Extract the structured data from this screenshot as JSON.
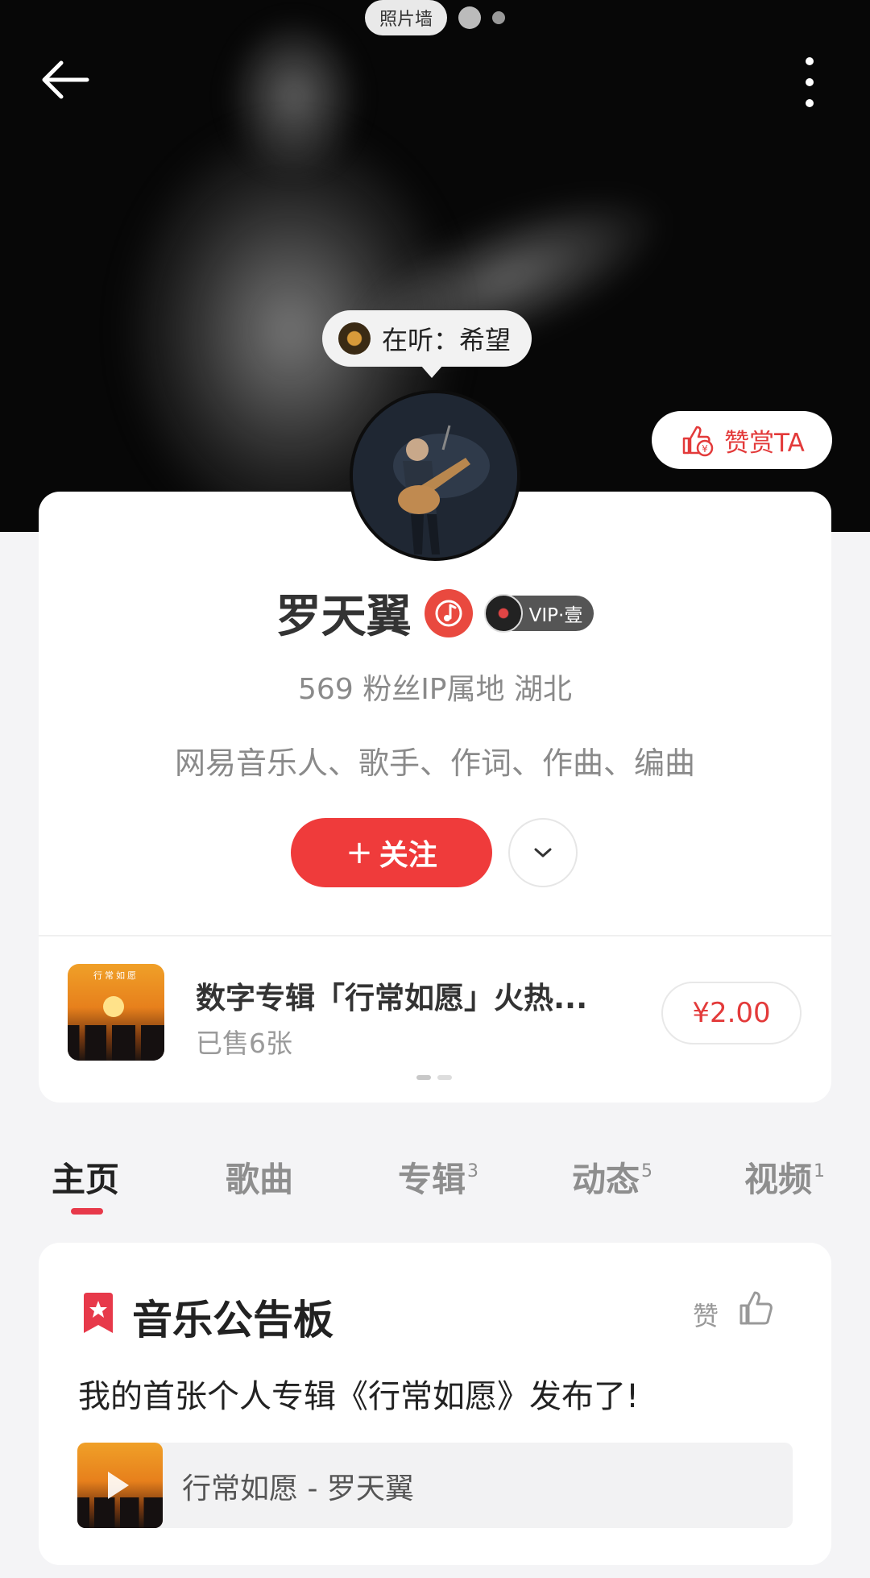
{
  "hero": {
    "photo_wall_label": "照片墙",
    "listening_label": "在听：希望",
    "tip_button_label": "赞赏TA"
  },
  "profile": {
    "name": "罗天翼",
    "vip_label": "VIP·壹",
    "stats": "569 粉丝IP属地 湖北",
    "bio": "网易音乐人、歌手、作词、作曲、编曲",
    "follow_label": "关注",
    "follow_plus": "+"
  },
  "promo": {
    "title": "数字专辑「行常如愿」火热...",
    "sold": "已售6张",
    "price": "¥2.00",
    "cover_text": "行常如愿"
  },
  "tabs": [
    {
      "label": "主页",
      "count": ""
    },
    {
      "label": "歌曲",
      "count": ""
    },
    {
      "label": "专辑",
      "count": "3"
    },
    {
      "label": "动态",
      "count": "5"
    },
    {
      "label": "视频",
      "count": "1"
    }
  ],
  "board": {
    "title": "音乐公告板",
    "like_label": "赞",
    "text": "我的首张个人专辑《行常如愿》发布了!",
    "song": "行常如愿 - 罗天翼"
  },
  "colors": {
    "accent_red": "#ef3b3b",
    "tab_underline": "#e7394a",
    "text_muted": "#8a8a8a"
  }
}
